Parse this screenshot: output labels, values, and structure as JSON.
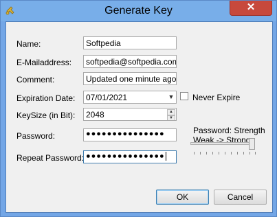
{
  "window": {
    "title": "Generate Key",
    "close_label": "✕",
    "close_color": "#c7493c",
    "titlebar_color": "#78aee9"
  },
  "form": {
    "name": {
      "label": "Name:",
      "value": "Softpedia"
    },
    "email": {
      "label": "E-Mailaddress:",
      "value": "softpedia@softpedia.com"
    },
    "comment": {
      "label": "Comment:",
      "value": "Updated one minute ago."
    },
    "expiration": {
      "label": "Expiration Date:",
      "value": "07/01/2021"
    },
    "never_expire": {
      "label": "Never Expire",
      "checked": false
    },
    "keysize": {
      "label": "KeySize (in Bit):",
      "value": "2048"
    },
    "password": {
      "label": "Password:",
      "value": "●●●●●●●●●●●●●●●"
    },
    "repeat_password": {
      "label": "Repeat Password:",
      "value": "●●●●●●●●●●●●●●●"
    },
    "strength": {
      "label": "Password: Strength",
      "hint": "Weak -> Strong",
      "level": 1.0
    }
  },
  "buttons": {
    "ok": "OK",
    "cancel": "Cancel"
  },
  "icons": {
    "app": "key-icon",
    "dropdown": "chevron-down-icon",
    "spin_up": "spin-up-icon",
    "spin_down": "spin-down-icon"
  }
}
